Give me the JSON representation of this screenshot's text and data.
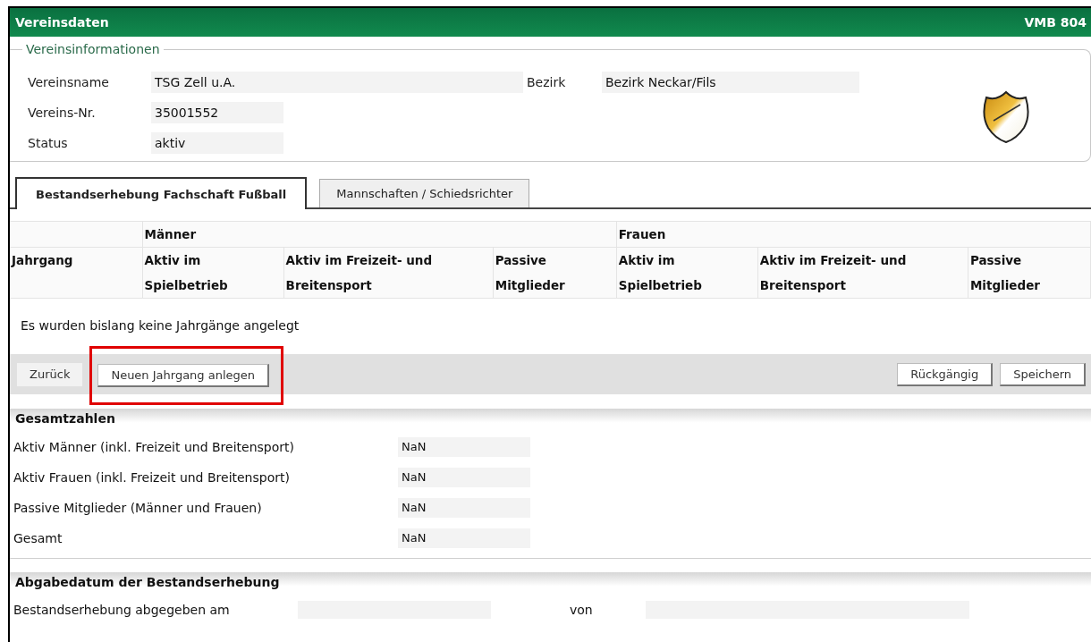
{
  "window": {
    "title": "Vereinsdaten",
    "code": "VMB 804"
  },
  "club_info": {
    "legend": "Vereinsinformationen",
    "fields": [
      {
        "label": "Vereinsname",
        "value": "TSG Zell u.A."
      },
      {
        "label": "Vereins-Nr.",
        "value": "35001552"
      },
      {
        "label": "Status",
        "value": "aktiv"
      }
    ],
    "district": {
      "label": "Bezirk",
      "value": "Bezirk Neckar/Fils"
    }
  },
  "tabs": [
    {
      "label": "Bestandserhebung Fachschaft Fußball",
      "selected": true
    },
    {
      "label": "Mannschaften / Schiedsrichter",
      "selected": false
    }
  ],
  "table": {
    "groups": [
      "Männer",
      "Frauen"
    ],
    "columns": [
      "Jahrgang",
      "Aktiv im Spielbetrieb",
      "Aktiv im Freizeit- und Breitensport",
      "Passive Mitglieder",
      "Aktiv im Spielbetrieb",
      "Aktiv im Freizeit- und Breitensport",
      "Passive Mitglieder"
    ],
    "empty_message": "Es wurden bislang keine Jahrgänge angelegt"
  },
  "button_bar": {
    "left": [
      {
        "label": "Zurück",
        "kind": "flat",
        "highlighted": false
      },
      {
        "label": "Neuen Jahrgang anlegen",
        "kind": "raised",
        "highlighted": true
      }
    ],
    "right": [
      {
        "label": "Rückgängig",
        "kind": "raised",
        "highlighted": false
      },
      {
        "label": "Speichern",
        "kind": "raised",
        "highlighted": false
      }
    ]
  },
  "totals": {
    "title": "Gesamtzahlen",
    "rows": [
      {
        "label": "Aktiv Männer (inkl. Freizeit und Breitensport)",
        "value": "NaN"
      },
      {
        "label": "Aktiv Frauen (inkl. Freizeit und Breitensport)",
        "value": "NaN"
      },
      {
        "label": "Passive Mitglieder (Männer und Frauen)",
        "value": "NaN"
      },
      {
        "label": "Gesamt",
        "value": "NaN"
      }
    ]
  },
  "submission": {
    "title": "Abgabedatum der Bestandserhebung",
    "label": "Bestandserhebung abgegeben am",
    "by_label": "von"
  }
}
